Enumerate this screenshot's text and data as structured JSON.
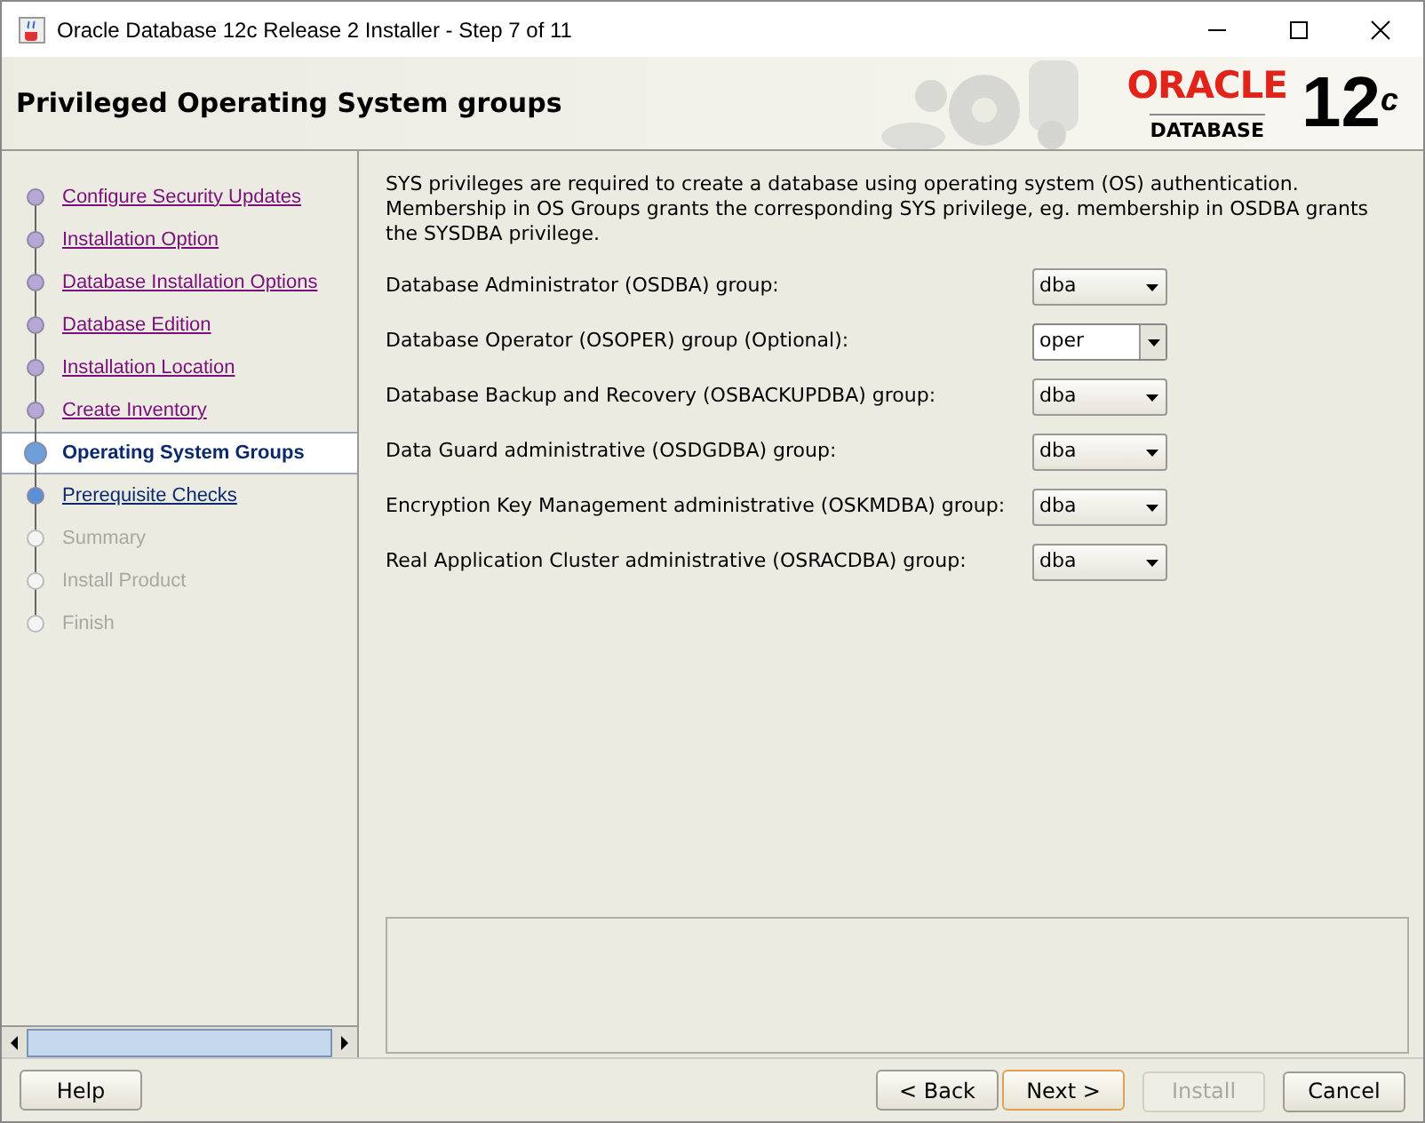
{
  "window": {
    "title": "Oracle Database 12c Release 2 Installer - Step 7 of 11"
  },
  "header": {
    "title": "Privileged Operating System groups",
    "logo_word": "ORACLE",
    "logo_sub": "DATABASE",
    "version": "12",
    "version_sup": "c"
  },
  "steps": [
    {
      "label": "Configure Security Updates",
      "visited": true,
      "selected": false,
      "disabled": false
    },
    {
      "label": "Installation Option",
      "visited": true,
      "selected": false,
      "disabled": false
    },
    {
      "label": "Database Installation Options",
      "visited": true,
      "selected": false,
      "disabled": false
    },
    {
      "label": "Database Edition",
      "visited": true,
      "selected": false,
      "disabled": false
    },
    {
      "label": "Installation Location",
      "visited": true,
      "selected": false,
      "disabled": false
    },
    {
      "label": "Create Inventory",
      "visited": true,
      "selected": false,
      "disabled": false
    },
    {
      "label": "Operating System Groups",
      "visited": false,
      "selected": true,
      "disabled": false
    },
    {
      "label": "Prerequisite Checks",
      "visited": false,
      "selected": false,
      "disabled": false
    },
    {
      "label": "Summary",
      "visited": false,
      "selected": false,
      "disabled": true
    },
    {
      "label": "Install Product",
      "visited": false,
      "selected": false,
      "disabled": true
    },
    {
      "label": "Finish",
      "visited": false,
      "selected": false,
      "disabled": true
    }
  ],
  "description": "SYS privileges are required to create a database using operating system (OS) authentication. Membership in OS Groups grants the corresponding SYS privilege, eg. membership in OSDBA grants the SYSDBA privilege.",
  "groups": [
    {
      "label": "Database Administrator (OSDBA) group:",
      "value": "dba",
      "editable": false
    },
    {
      "label": "Database Operator (OSOPER) group (Optional):",
      "value": "oper",
      "editable": true
    },
    {
      "label": "Database Backup and Recovery (OSBACKUPDBA) group:",
      "value": "dba",
      "editable": false
    },
    {
      "label": "Data Guard administrative (OSDGDBA) group:",
      "value": "dba",
      "editable": false
    },
    {
      "label": "Encryption Key Management administrative (OSKMDBA) group:",
      "value": "dba",
      "editable": false
    },
    {
      "label": "Real Application Cluster administrative (OSRACDBA) group:",
      "value": "dba",
      "editable": false
    }
  ],
  "buttons": [
    {
      "label": "Help",
      "disabled": false,
      "default": false
    },
    {
      "label": "< Back",
      "disabled": false,
      "default": false
    },
    {
      "label": "Next >",
      "disabled": false,
      "default": true
    },
    {
      "label": "Install",
      "disabled": true,
      "default": false
    },
    {
      "label": "Cancel",
      "disabled": false,
      "default": false
    }
  ]
}
